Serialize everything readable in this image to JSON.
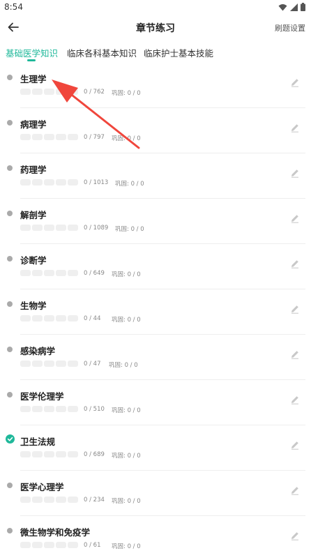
{
  "status": {
    "time": "8:54"
  },
  "header": {
    "title": "章节练习",
    "settings": "刷题设置"
  },
  "tabs": [
    {
      "label": "基础医学知识",
      "active": true
    },
    {
      "label": "临床各科基本知识",
      "active": false
    },
    {
      "label": "临床护士基本技能",
      "active": false
    }
  ],
  "chapters": [
    {
      "name": "生理学",
      "count": "0 / 762",
      "review": "巩固: 0 / 0",
      "done": false
    },
    {
      "name": "病理学",
      "count": "0 / 797",
      "review": "巩固: 0 / 0",
      "done": false
    },
    {
      "name": "药理学",
      "count": "0 / 1013",
      "review": "巩固: 0 / 0",
      "done": false
    },
    {
      "name": "解剖学",
      "count": "0 / 1089",
      "review": "巩固: 0 / 0",
      "done": false
    },
    {
      "name": "诊断学",
      "count": "0 / 649",
      "review": "巩固: 0 / 0",
      "done": false
    },
    {
      "name": "生物学",
      "count": "0 / 44",
      "review": "巩固: 0 / 0",
      "done": false
    },
    {
      "name": "感染病学",
      "count": "0 / 47",
      "review": "巩固: 0 / 0",
      "done": false
    },
    {
      "name": "医学伦理学",
      "count": "0 / 510",
      "review": "巩固: 0 / 0",
      "done": false
    },
    {
      "name": "卫生法规",
      "count": "0 / 689",
      "review": "巩固: 0 / 0",
      "done": true
    },
    {
      "name": "医学心理学",
      "count": "0 / 234",
      "review": "巩固: 0 / 0",
      "done": false
    },
    {
      "name": "微生物学和免疫学",
      "count": "0 / 61",
      "review": "巩固: 0 / 0",
      "done": false
    }
  ],
  "colors": {
    "accent": "#1fb89a",
    "annotation_arrow": "#f0463c"
  },
  "icons": {
    "back": "arrow-left-icon",
    "edit": "pencil-icon",
    "done": "check-circle-icon",
    "wifi": "wifi-icon",
    "signal": "signal-icon",
    "battery": "battery-icon"
  }
}
